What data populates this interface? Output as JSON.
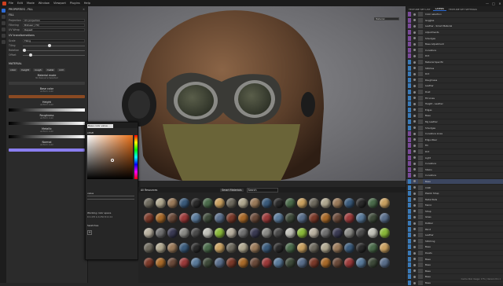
{
  "menu": {
    "items": [
      "File",
      "Edit",
      "Mode",
      "Window",
      "Viewport",
      "Plugins",
      "Help"
    ],
    "window_controls": [
      "—",
      "□",
      "✕"
    ]
  },
  "properties": {
    "title": "PROPERTIES - FILL",
    "section_fill": "FILL",
    "projection_label": "Projection",
    "projection_value": "UV projection",
    "filtering_label": "Filtering",
    "filtering_value": "Bilinear | HQ",
    "uvwrap_label": "UV Wrap",
    "uvwrap_value": "Repeat",
    "transform_label": "UV transformations",
    "scale_label": "Scale",
    "scale_value": "Tiling",
    "tiling_label": "Tiling",
    "rotation_label": "Rotation",
    "offset_label": "Offset",
    "material_section": "MATERIAL",
    "channel_pills": [
      "color",
      "height",
      "rough",
      "metal",
      "nrm"
    ],
    "material_mode_title": "Material mode",
    "material_mode_sub": "No Resource Selected",
    "channels": [
      {
        "title": "Base color",
        "sub": "uniform color",
        "color": "#8a4a22"
      },
      {
        "title": "Height",
        "sub": "uniform color"
      },
      {
        "title": "Roughness",
        "sub": "uniform color"
      },
      {
        "title": "Metallic",
        "sub": "uniform color"
      },
      {
        "title": "Normal",
        "sub": "uniform color",
        "color": "#8a7ef0"
      }
    ]
  },
  "picker": {
    "search": "Base color value",
    "mode": "sRGB",
    "value_label": "value",
    "working_space_label": "Working color space",
    "rgb_line": "R 0.478 G 0.250 B 0.114",
    "swatches_label": "Swatches",
    "swatch_add": "+"
  },
  "library": {
    "title": "All Resources",
    "search_placeholder": "Search",
    "filter_chip": "Smart Materials"
  },
  "layers": {
    "tabs": [
      "TEXTURE SET LIST",
      "LAYERS",
      "TEXTURE SET SETTINGS"
    ],
    "rows": [
      {
        "name": "Color selection",
        "color": "#7a4a9a"
      },
      {
        "name": "Goggles",
        "color": "#7a4a9a"
      },
      {
        "name": "Leather - Smart Material",
        "color": "#7a4a9a"
      },
      {
        "name": "Adjustments",
        "color": "#7a4a9a"
      },
      {
        "name": "Smudges",
        "color": "#7a4a9a"
      },
      {
        "name": "Base Adjustment",
        "color": "#7a4a9a"
      },
      {
        "name": "Curvature",
        "color": "#7a4a9a"
      },
      {
        "name": "Dirt",
        "color": "#7a4a9a"
      },
      {
        "name": "Material Specific",
        "color": "#3a7ab8"
      },
      {
        "name": "Stitches",
        "color": "#3a7ab8"
      },
      {
        "name": "Dirt",
        "color": "#3a7ab8"
      },
      {
        "name": "Roughness",
        "color": "#3a7ab8"
      },
      {
        "name": "Leather",
        "color": "#3a7ab8"
      },
      {
        "name": "Dust",
        "color": "#3a7ab8"
      },
      {
        "name": "Fill Lines",
        "color": "#3a7ab8"
      },
      {
        "name": "Height - Leather",
        "color": "#3a7ab8"
      },
      {
        "name": "Edges",
        "color": "#3a7ab8"
      },
      {
        "name": "Base",
        "color": "#3a7ab8"
      },
      {
        "name": "Mg Leather",
        "color": "#3a7ab8"
      },
      {
        "name": "Smudges",
        "color": "#3a7ab8"
      },
      {
        "name": "Curvature Lines",
        "color": "#7a4a9a"
      },
      {
        "name": "Edge Wear",
        "color": "#7a4a9a"
      },
      {
        "name": "Fill",
        "color": "#7a4a9a"
      },
      {
        "name": "Dirt",
        "color": "#7a4a9a"
      },
      {
        "name": "Light",
        "color": "#7a4a9a"
      },
      {
        "name": "Curvature",
        "color": "#7a4a9a"
      },
      {
        "name": "Stains",
        "color": "#7a4a9a"
      },
      {
        "name": "Curvature",
        "color": "#7a4a9a"
      },
      {
        "name": "Base",
        "color": "#3a7ab8",
        "selected": true
      },
      {
        "name": "Cloth",
        "color": "#3a7ab8"
      },
      {
        "name": "Plastic Strap",
        "color": "#3a7ab8"
      },
      {
        "name": "Metal Pads",
        "color": "#3a7ab8"
      },
      {
        "name": "Fabric",
        "color": "#3a7ab8"
      },
      {
        "name": "Strap",
        "color": "#3a7ab8"
      },
      {
        "name": "Glass",
        "color": "#3a7ab8"
      },
      {
        "name": "Rubber",
        "color": "#3a7ab8"
      },
      {
        "name": "Paint",
        "color": "#3a7ab8"
      },
      {
        "name": "Leather",
        "color": "#3a7ab8"
      },
      {
        "name": "Stitching",
        "color": "#3a7ab8"
      },
      {
        "name": "Base",
        "color": "#3a7ab8"
      },
      {
        "name": "Rivets",
        "color": "#3a7ab8"
      },
      {
        "name": "Base",
        "color": "#3a7ab8"
      },
      {
        "name": "Base",
        "color": "#3a7ab8"
      },
      {
        "name": "Base",
        "color": "#3a7ab8"
      },
      {
        "name": "Base",
        "color": "#3a7ab8"
      },
      {
        "name": "Base",
        "color": "#3a7ab8"
      }
    ]
  },
  "viewport": {
    "mode": "Material"
  },
  "status": "Cache Disk Usage: 17% | Version 8.1.1"
}
